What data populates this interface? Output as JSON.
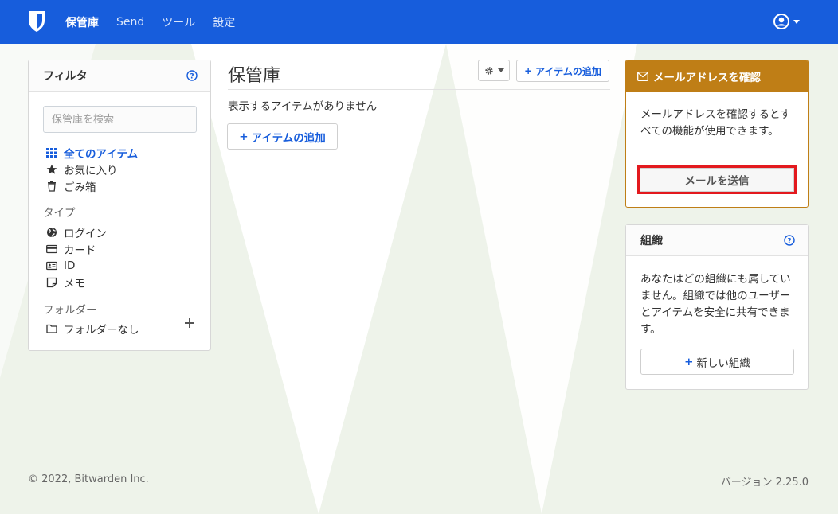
{
  "nav": {
    "items": [
      {
        "label": "保管庫",
        "active": true
      },
      {
        "label": "Send",
        "active": false
      },
      {
        "label": "ツール",
        "active": false
      },
      {
        "label": "設定",
        "active": false
      }
    ],
    "account_icon": "user-circle-icon"
  },
  "filter": {
    "title": "フィルタ",
    "search_placeholder": "保管庫を検索",
    "items": [
      {
        "label": "全てのアイテム",
        "icon": "grid-icon",
        "active": true
      },
      {
        "label": "お気に入り",
        "icon": "star-icon",
        "active": false
      },
      {
        "label": "ごみ箱",
        "icon": "trash-icon",
        "active": false
      }
    ],
    "type_heading": "タイプ",
    "types": [
      {
        "label": "ログイン",
        "icon": "globe-icon"
      },
      {
        "label": "カード",
        "icon": "credit-card-icon"
      },
      {
        "label": "ID",
        "icon": "id-card-icon"
      },
      {
        "label": "メモ",
        "icon": "note-icon"
      }
    ],
    "folder_heading": "フォルダー",
    "folders": [
      {
        "label": "フォルダーなし",
        "icon": "folder-icon"
      }
    ]
  },
  "main": {
    "title": "保管庫",
    "add_item_label": "アイテムの追加",
    "empty_text": "表示するアイテムがありません",
    "add_item_main_label": "アイテムの追加"
  },
  "verify": {
    "title": "メールアドレスを確認",
    "text": "メールアドレスを確認するとすべての機能が使用できます。",
    "button": "メールを送信",
    "color": "#bf7e16",
    "highlight_color": "#e3191e"
  },
  "org": {
    "title": "組織",
    "text": "あなたはどの組織にも属していません。組織では他のユーザーとアイテムを安全に共有できます。",
    "button": "新しい組織"
  },
  "footer": {
    "copyright": "© 2022, Bitwarden Inc.",
    "version": "バージョン 2.25.0"
  },
  "colors": {
    "brand": "#175ddc",
    "background": "#eef3ea"
  }
}
